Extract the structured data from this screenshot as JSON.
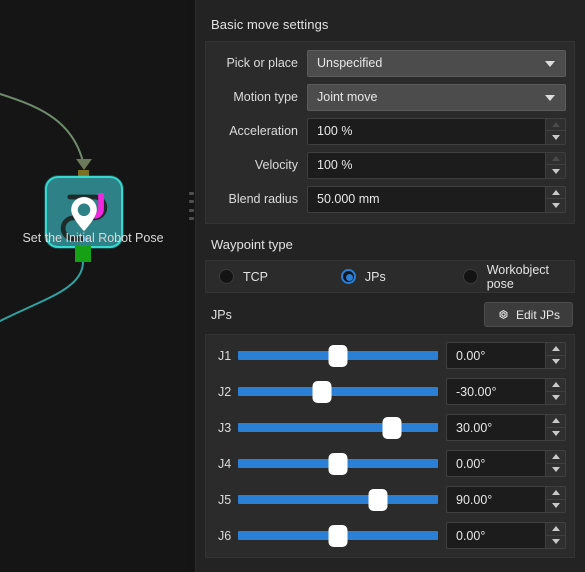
{
  "graph": {
    "node": {
      "label": "Set the Initial Robot Pose",
      "icon": "robot-pose-pin-icon",
      "card_color": "#2e8287",
      "border_color": "#36d9cf",
      "input_port_color": "#7a6f23",
      "output_port_color": "#16a016",
      "incoming_edge_color": "#6f8a6c",
      "outgoing_edge_color": "#2fa3a3"
    }
  },
  "panel": {
    "basic_title": "Basic move settings",
    "fields": [
      {
        "label": "Pick or place",
        "type": "combo",
        "value": "Unspecified",
        "icon": "chevron-down-icon"
      },
      {
        "label": "Motion type",
        "type": "combo",
        "value": "Joint move",
        "icon": "chevron-down-icon"
      },
      {
        "label": "Acceleration",
        "type": "spin",
        "value": "100 %",
        "up_disabled": true,
        "down_disabled": false
      },
      {
        "label": "Velocity",
        "type": "spin",
        "value": "100 %",
        "up_disabled": true,
        "down_disabled": false
      },
      {
        "label": "Blend radius",
        "type": "spin",
        "value": "50.000 mm",
        "up_disabled": false,
        "down_disabled": false
      }
    ],
    "waypoint": {
      "title": "Waypoint type",
      "options": [
        {
          "label": "TCP",
          "selected": false
        },
        {
          "label": "JPs",
          "selected": true
        },
        {
          "label": "Workobject pose",
          "selected": false
        }
      ],
      "selected_value": "JPs",
      "accent_color": "#2b7fd4"
    },
    "jps": {
      "section_label": "JPs",
      "edit_button": {
        "label": "Edit JPs",
        "icon": "gear-icon"
      },
      "joints": [
        {
          "name": "J1",
          "value": "0.00°",
          "percent": 50
        },
        {
          "name": "J2",
          "value": "-30.00°",
          "percent": 42
        },
        {
          "name": "J3",
          "value": "30.00°",
          "percent": 77
        },
        {
          "name": "J4",
          "value": "0.00°",
          "percent": 50
        },
        {
          "name": "J5",
          "value": "90.00°",
          "percent": 70
        },
        {
          "name": "J6",
          "value": "0.00°",
          "percent": 50
        }
      ],
      "slider_color": "#2b7fd4",
      "thumb_color": "#ffffff"
    }
  }
}
